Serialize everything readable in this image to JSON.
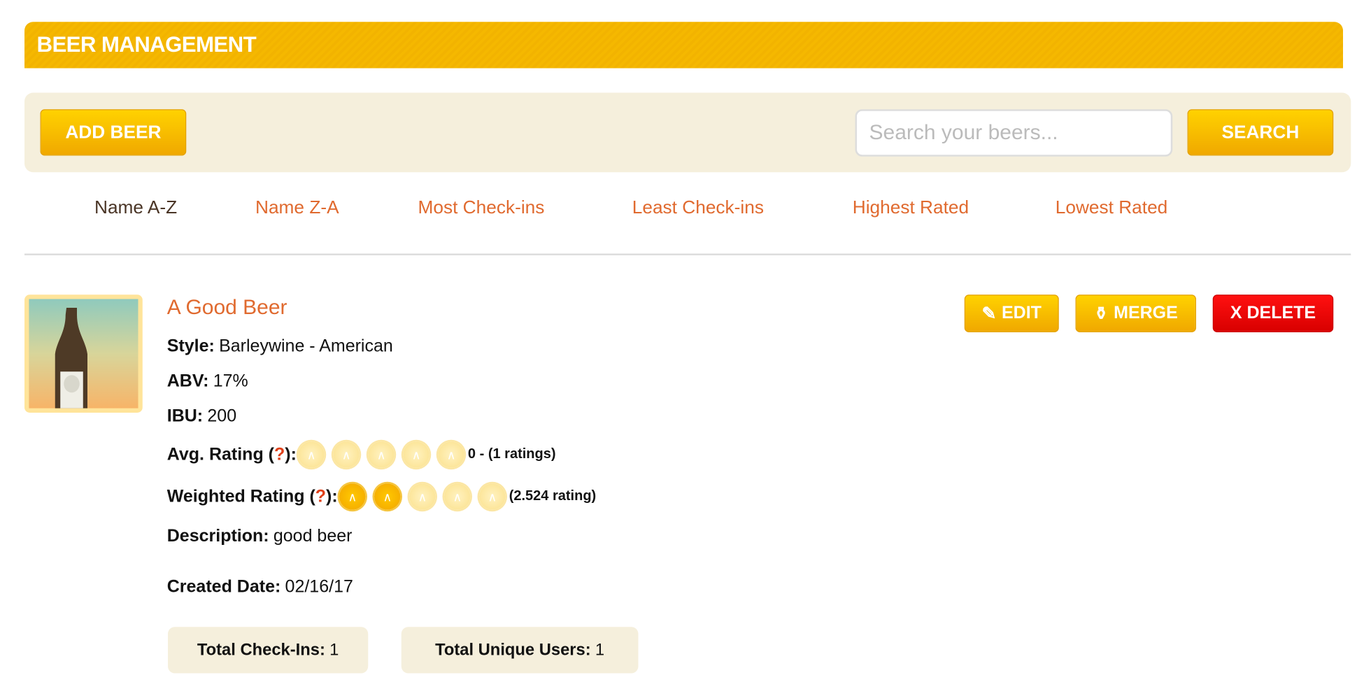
{
  "header": {
    "title": "BEER MANAGEMENT",
    "color": "#f5b800"
  },
  "toolbar": {
    "add_label": "ADD BEER",
    "search_placeholder": "Search your beers...",
    "search_value": "",
    "search_label": "SEARCH"
  },
  "sort": [
    {
      "label": "Name A-Z",
      "active": true
    },
    {
      "label": "Name Z-A"
    },
    {
      "label": "Most Check-ins"
    },
    {
      "label": "Least Check-ins"
    },
    {
      "label": "Highest Rated"
    },
    {
      "label": "Lowest Rated"
    }
  ],
  "beer": {
    "name": "A Good Beer",
    "style_label": "Style:",
    "style": "Barleywine - American",
    "abv_label": "ABV:",
    "abv": "17%",
    "ibu_label": "IBU:",
    "ibu": "200",
    "avg_label": "Avg. Rating (",
    "q": "?",
    "close": "):",
    "avg_caps_filled": 0,
    "avg_text": "0 - (1 ratings)",
    "weighted_label": "Weighted Rating (",
    "weighted_caps_filled": 2,
    "weighted_text": "(2.524 rating)",
    "desc_label": "Description:",
    "desc": "good beer",
    "created_label": "Created Date:",
    "created": "02/16/17",
    "checkins_label": "Total Check-Ins:",
    "checkins": "1",
    "users_label": "Total Unique Users:",
    "users": "1"
  },
  "actions": {
    "edit": "EDIT",
    "merge": "MERGE",
    "delete": "X DELETE",
    "delete_color": "#e00000"
  }
}
